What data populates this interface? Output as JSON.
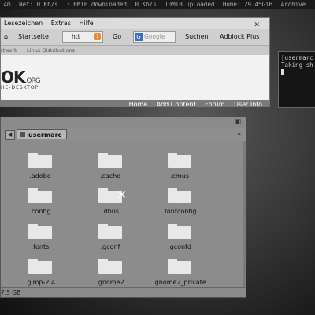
{
  "topbar": {
    "time": "14m",
    "net": "Net: 0 Kb/s",
    "downloaded": "3.6MiB downloaded",
    "up": "0 Kb/s",
    "uploaded": "10MiB uploaded",
    "home": "Home: 29.45GiB",
    "archive": "Archive"
  },
  "browser": {
    "menu": [
      "Lesezeichen",
      "Extras",
      "Hilfe"
    ],
    "toolbar": {
      "home_label": "Startseite",
      "url_text": "htt",
      "go_label": "Go",
      "search_placeholder": "Google",
      "search_button": "Suchen",
      "adblock_label": "Adblock Plus"
    },
    "sub_nav": [
      "rtwork",
      "Linux Distributions"
    ],
    "logo_main": "OK",
    "logo_org": ".ORG",
    "logo_sub": "HE-DESKTOP",
    "page_nav": [
      "Home",
      "Add Content",
      "Forum",
      "User Info"
    ]
  },
  "terminal": {
    "line1": "[usermarc",
    "line2": "Taking sh"
  },
  "file_manager": {
    "breadcrumb": "usermarc",
    "items": [
      ".adobe",
      ".cache",
      ".cmus",
      ".config",
      ".dbus",
      ".fontconfig",
      ".fonts",
      ".gconf",
      ".gconfd",
      ".gimp-2.4",
      ".gnome2",
      ".gnome2_private"
    ],
    "status": "7.5 GB"
  },
  "colors": {
    "background": "#3a3a3a",
    "folder": "#e8e8e8",
    "rss": "#e88a2a"
  }
}
